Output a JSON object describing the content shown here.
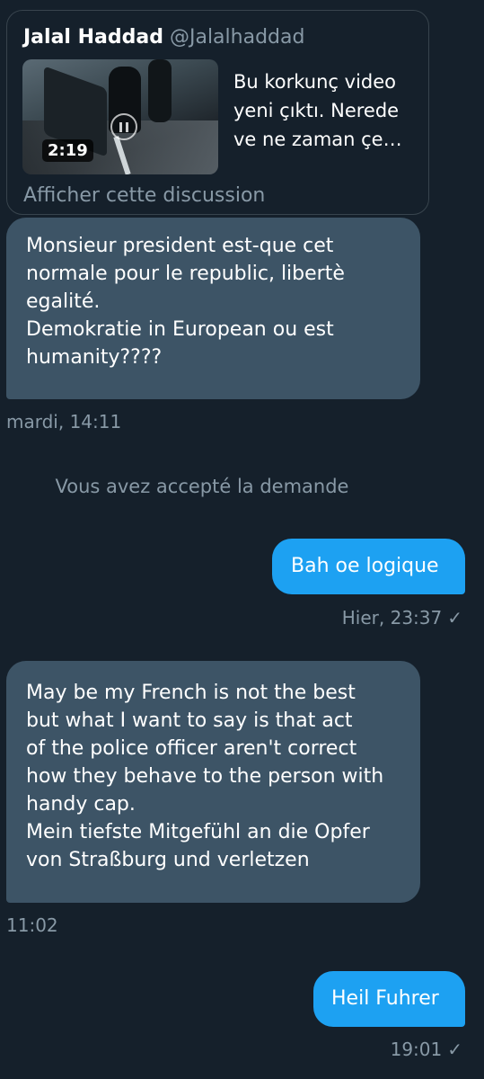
{
  "shared_tweet": {
    "name": "Jalal Haddad",
    "handle": "@Jalalhaddad",
    "video_duration": "2:19",
    "text": "Bu korkunç video\nyeni çıktı. Nerede\nve ne zaman çe…",
    "discussion_link": "Afficher cette discussion"
  },
  "messages": [
    {
      "direction": "in",
      "text": "Monsieur president est-que cet\nnormale pour le republic, libertè\negalité.\nDemokratie in European ou est\nhumanity????",
      "timestamp": "mardi, 14:11"
    },
    {
      "direction": "system",
      "text": "Vous avez accepté la demande"
    },
    {
      "direction": "out",
      "text": "Bah oe logique",
      "timestamp": "Hier, 23:37",
      "status": "✓"
    },
    {
      "direction": "in",
      "text": "May be my French is not the best\nbut what I want to say is that act\nof the police officer aren't correct\nhow they behave to the person with\nhandy cap.\nMein tiefste Mitgefühl an die Opfer\nvon Straßburg und verletzen",
      "timestamp": "11:02"
    },
    {
      "direction": "out",
      "text": "Heil Fuhrer",
      "timestamp": "19:01",
      "status": "✓"
    }
  ],
  "colors": {
    "background": "#15202b",
    "incoming_bubble": "#3d5466",
    "outgoing_bubble": "#1da1f2",
    "muted_text": "#8899a6"
  }
}
